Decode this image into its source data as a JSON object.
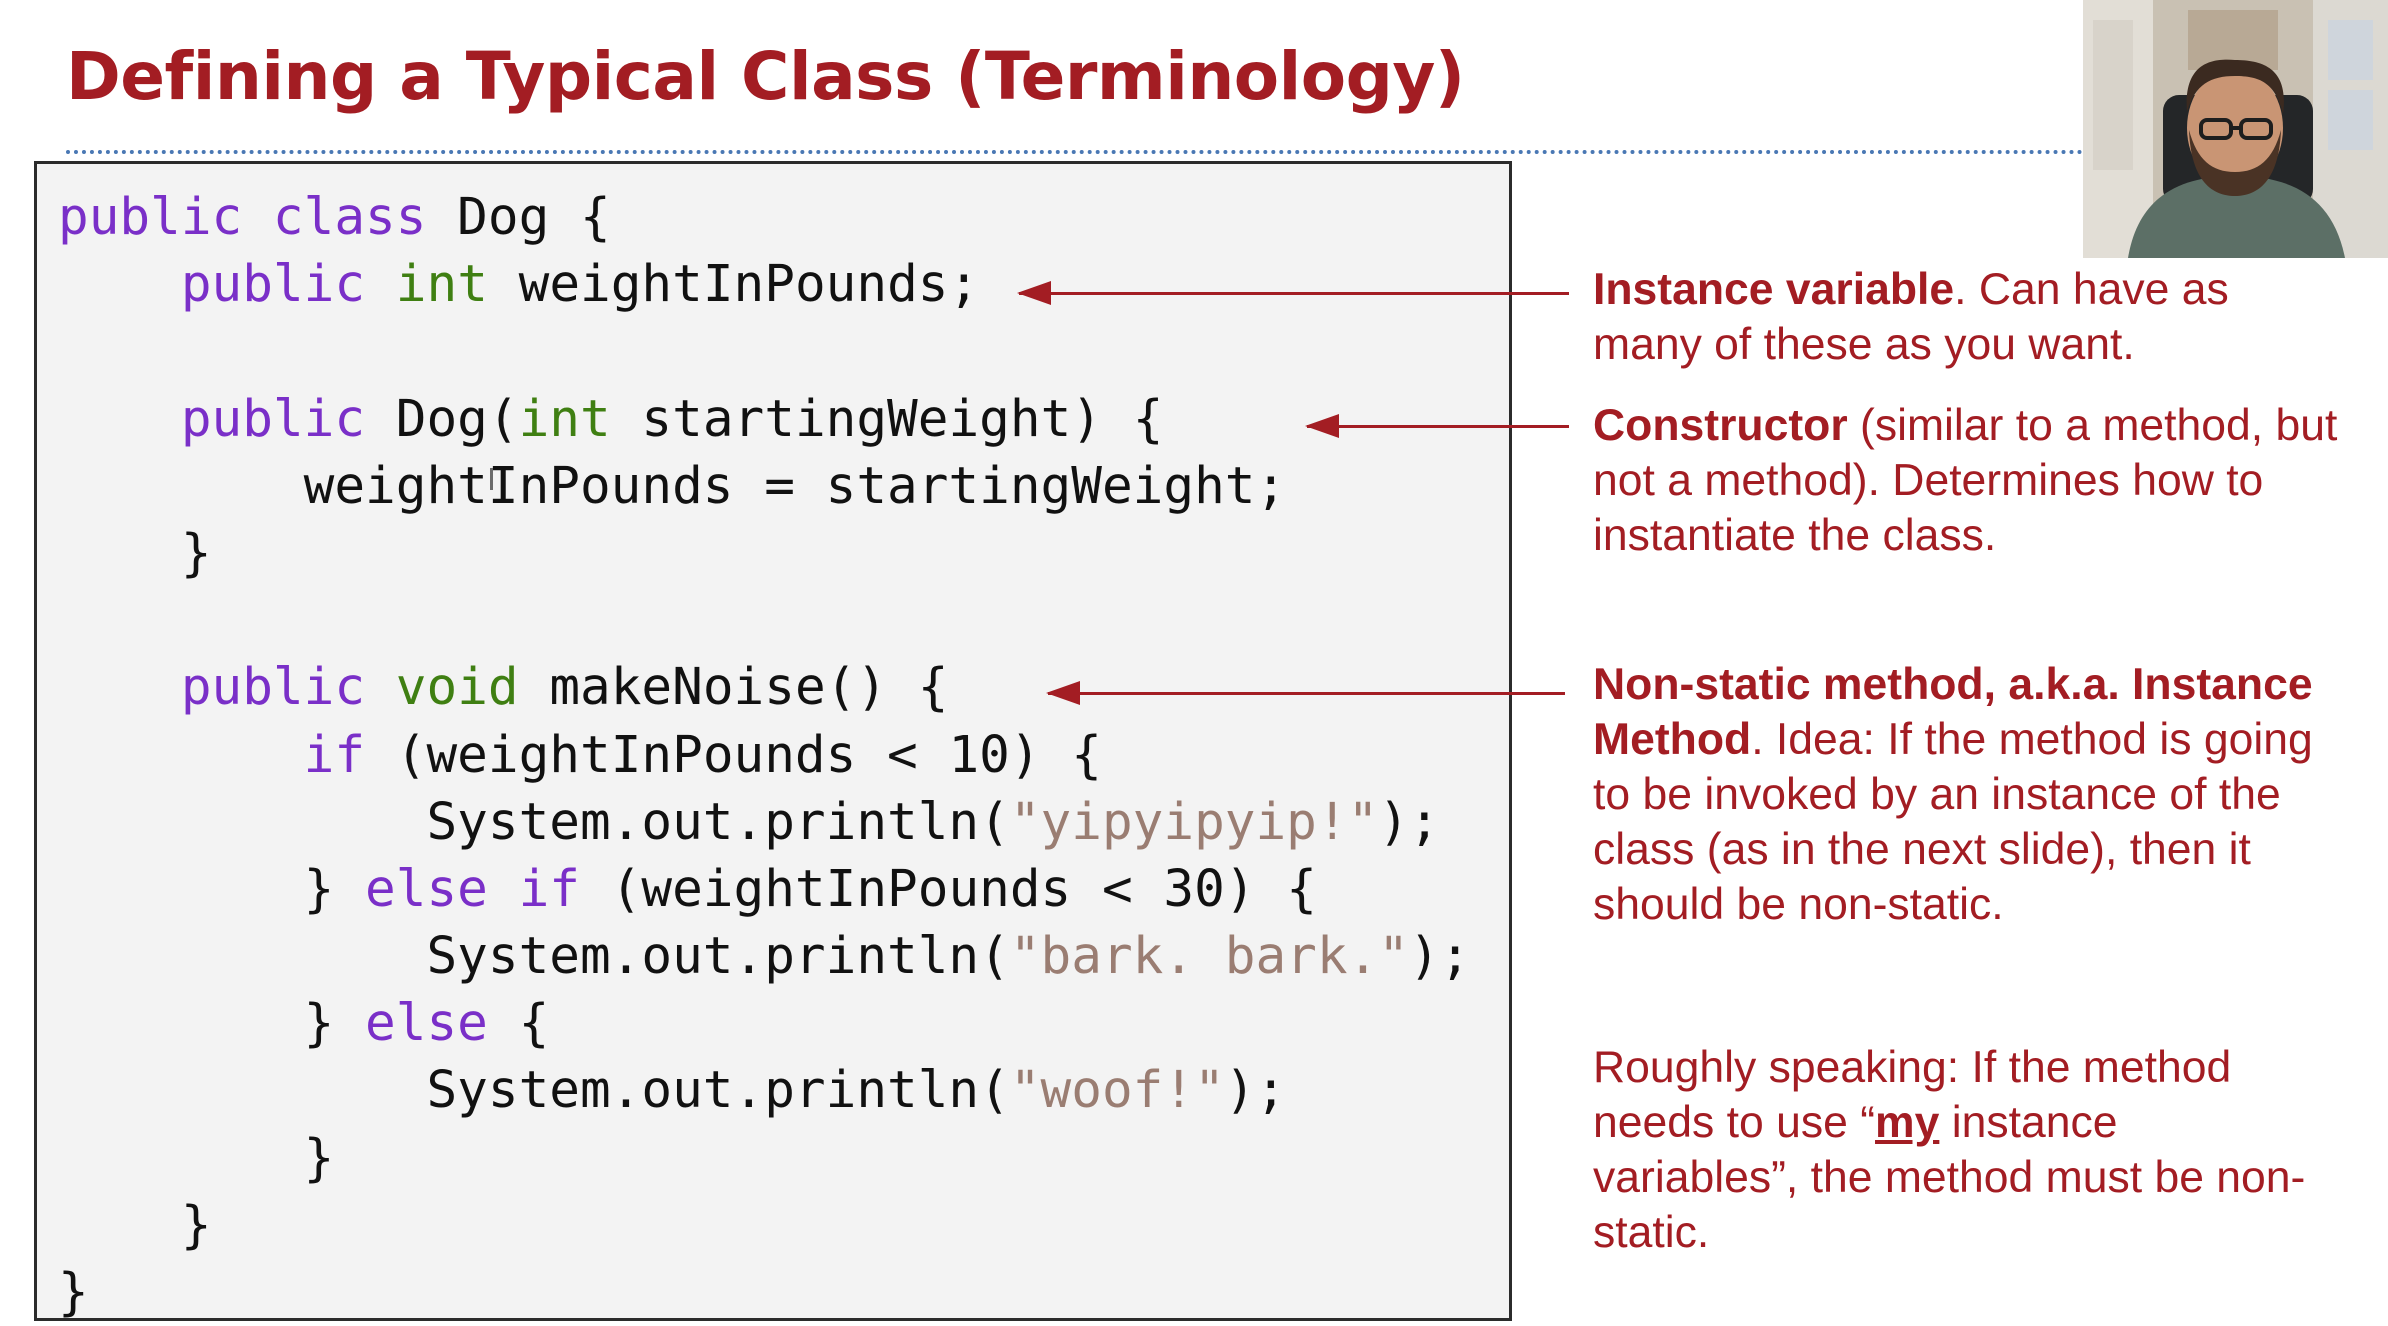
{
  "slide": {
    "title": "Defining a Typical Class (Terminology)"
  },
  "code": [
    [
      {
        "t": "public class",
        "c": "kw"
      },
      {
        "t": " Dog {"
      }
    ],
    [
      {
        "t": "    "
      },
      {
        "t": "public",
        "c": "kw"
      },
      {
        "t": " "
      },
      {
        "t": "int",
        "c": "ty"
      },
      {
        "t": " weightInPounds;"
      }
    ],
    [],
    [
      {
        "t": "    "
      },
      {
        "t": "public",
        "c": "kw"
      },
      {
        "t": " Dog("
      },
      {
        "t": "int",
        "c": "ty"
      },
      {
        "t": " startingWeight) {"
      }
    ],
    [
      {
        "t": "        weightInPounds = startingWeight;"
      }
    ],
    [
      {
        "t": "    }"
      }
    ],
    [],
    [
      {
        "t": "    "
      },
      {
        "t": "public",
        "c": "kw"
      },
      {
        "t": " "
      },
      {
        "t": "void",
        "c": "ty"
      },
      {
        "t": " makeNoise() {"
      }
    ],
    [
      {
        "t": "        "
      },
      {
        "t": "if",
        "c": "kw"
      },
      {
        "t": " (weightInPounds < 10) {"
      }
    ],
    [
      {
        "t": "            System.out.println("
      },
      {
        "t": "\"yipyipyip!\"",
        "c": "st"
      },
      {
        "t": ");"
      }
    ],
    [
      {
        "t": "        } "
      },
      {
        "t": "else if",
        "c": "kw"
      },
      {
        "t": " (weightInPounds < 30) {"
      }
    ],
    [
      {
        "t": "            System.out.println("
      },
      {
        "t": "\"bark. bark.\"",
        "c": "st"
      },
      {
        "t": ");"
      }
    ],
    [
      {
        "t": "        } "
      },
      {
        "t": "else",
        "c": "kw"
      },
      {
        "t": " {"
      }
    ],
    [
      {
        "t": "            System.out.println("
      },
      {
        "t": "\"woof!\"",
        "c": "st"
      },
      {
        "t": ");"
      }
    ],
    [
      {
        "t": "        }"
      }
    ],
    [
      {
        "t": "    }"
      }
    ],
    [
      {
        "t": "}"
      }
    ]
  ],
  "annotations": {
    "instance_variable": {
      "bold": "Instance variable",
      "text": ". Can have as many of these as you want."
    },
    "constructor": {
      "bold": "Constructor",
      "text": " (similar to a method, but not a method). Determines how to instantiate the class."
    },
    "nonstatic_method": {
      "bold": "Non-static method, a.k.a. Instance Method",
      "text": ". Idea: If the method is going to be invoked by an instance of the class (as in the next slide), then it should be non-static."
    },
    "roughly": {
      "prefix": "Roughly speaking: If the method needs to use “",
      "emphasis": "my",
      "suffix": " instance variables”, the method must be non-static."
    }
  },
  "colors": {
    "accent_red": "#a31d23",
    "keyword_purple": "#7a2fc8",
    "type_green": "#3f7f12",
    "string_taupe": "#9a7d72",
    "rule_blue": "#4a78b4"
  }
}
